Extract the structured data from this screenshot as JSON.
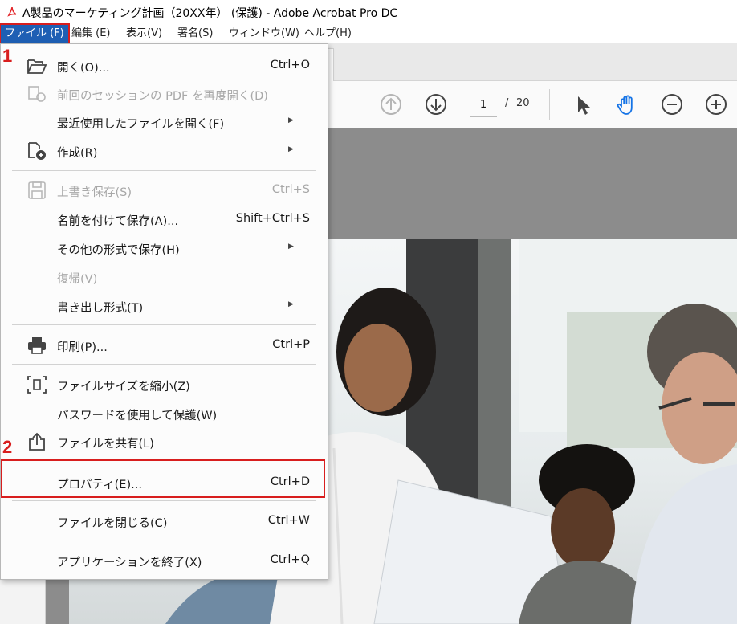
{
  "window": {
    "title": "A製品のマーケティング計画（20XX年） (保護) - Adobe Acrobat Pro DC"
  },
  "menubar": {
    "items": [
      {
        "id": "file",
        "label": "ファイル (F)"
      },
      {
        "id": "edit",
        "label": "編集 (E)"
      },
      {
        "id": "view",
        "label": "表示(V)"
      },
      {
        "id": "sign",
        "label": "署名(S)"
      },
      {
        "id": "window",
        "label": "ウィンドウ(W)"
      },
      {
        "id": "help",
        "label": "ヘルプ(H)"
      }
    ]
  },
  "toolbar": {
    "page_current": "1",
    "page_sep": "/",
    "page_total": "20"
  },
  "file_menu": {
    "open": {
      "label": "開く(O)...",
      "shortcut": "Ctrl+O"
    },
    "reopen": {
      "label": "前回のセッションの PDF を再度開く(D)"
    },
    "recent": {
      "label": "最近使用したファイルを開く(F)"
    },
    "create": {
      "label": "作成(R)"
    },
    "save": {
      "label": "上書き保存(S)",
      "shortcut": "Ctrl+S"
    },
    "save_as": {
      "label": "名前を付けて保存(A)...",
      "shortcut": "Shift+Ctrl+S"
    },
    "save_other": {
      "label": "その他の形式で保存(H)"
    },
    "revert": {
      "label": "復帰(V)"
    },
    "export": {
      "label": "書き出し形式(T)"
    },
    "print": {
      "label": "印刷(P)...",
      "shortcut": "Ctrl+P"
    },
    "reduce": {
      "label": "ファイルサイズを縮小(Z)"
    },
    "password": {
      "label": "パスワードを使用して保護(W)"
    },
    "share": {
      "label": "ファイルを共有(L)"
    },
    "properties": {
      "label": "プロパティ(E)...",
      "shortcut": "Ctrl+D"
    },
    "close": {
      "label": "ファイルを閉じる(C)",
      "shortcut": "Ctrl+W"
    },
    "quit": {
      "label": "アプリケーションを終了(X)",
      "shortcut": "Ctrl+Q"
    }
  },
  "annotations": {
    "step1": "1",
    "step2": "2"
  },
  "colors": {
    "accent": "#1e5fb4",
    "highlight": "#d81e1e",
    "hand_tool": "#1473e6"
  }
}
